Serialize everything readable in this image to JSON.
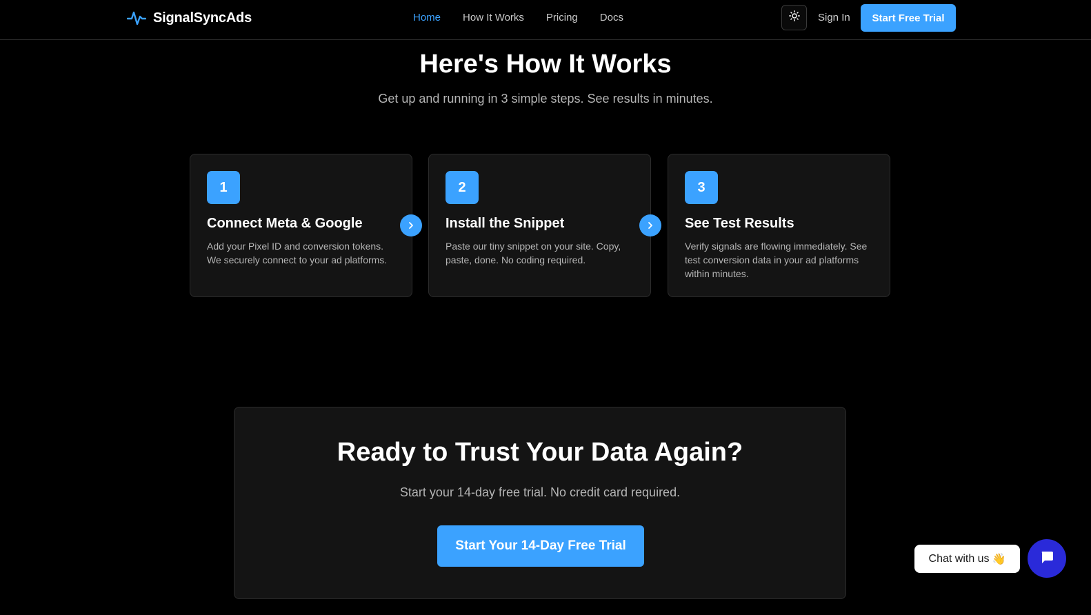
{
  "header": {
    "brand": "SignalSyncAds",
    "brand_icon": "pulse-icon",
    "nav": [
      {
        "label": "Home",
        "active": true
      },
      {
        "label": "How It Works",
        "active": false
      },
      {
        "label": "Pricing",
        "active": false
      },
      {
        "label": "Docs",
        "active": false
      }
    ],
    "theme_icon": "sun-icon",
    "sign_in": "Sign In",
    "trial_button": "Start Free Trial"
  },
  "how_it_works": {
    "title": "Here's How It Works",
    "subtitle": "Get up and running in 3 simple steps. See results in minutes.",
    "steps": [
      {
        "number": "1",
        "title": "Connect Meta & Google",
        "description": "Add your Pixel ID and conversion tokens. We securely connect to your ad platforms."
      },
      {
        "number": "2",
        "title": "Install the Snippet",
        "description": "Paste our tiny snippet on your site. Copy, paste, done. No coding required."
      },
      {
        "number": "3",
        "title": "See Test Results",
        "description": "Verify signals are flowing immediately. See test conversion data in your ad platforms within minutes."
      }
    ]
  },
  "cta": {
    "title": "Ready to Trust Your Data Again?",
    "subtitle": "Start your 14-day free trial. No credit card required.",
    "button": "Start Your 14-Day Free Trial"
  },
  "chat": {
    "bubble_text": "Chat with us",
    "bubble_emoji": "👋",
    "launcher_icon": "chat-icon"
  },
  "colors": {
    "accent": "#3ba2ff",
    "background": "#000000",
    "card": "#141414",
    "chat_launcher": "#2a2ad9"
  }
}
